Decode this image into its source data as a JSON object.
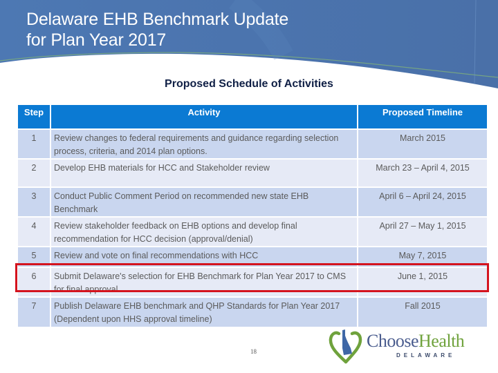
{
  "slide": {
    "title_line1": "Delaware EHB Benchmark Update",
    "title_line2": "for Plan Year 2017",
    "subtitle": "Proposed Schedule of Activities",
    "page_number": "18"
  },
  "table": {
    "headers": {
      "step": "Step",
      "activity": "Activity",
      "timeline": "Proposed Timeline"
    },
    "rows": [
      {
        "step": "1",
        "activity": "Review changes to federal requirements and guidance regarding selection process, criteria, and 2014 plan options.",
        "timeline": "March 2015"
      },
      {
        "step": "2",
        "activity": "Develop EHB materials for HCC and Stakeholder review",
        "timeline": "March 23 – April 4, 2015"
      },
      {
        "step": "3",
        "activity": "Conduct Public Comment Period on recommended new state EHB Benchmark",
        "timeline": "April 6 – April 24, 2015"
      },
      {
        "step": "4",
        "activity": "Review stakeholder feedback on EHB options and develop final recommendation for HCC decision (approval/denial)",
        "timeline": "April 27 – May 1, 2015"
      },
      {
        "step": "5",
        "activity": "Review and vote on final recommendations with HCC",
        "timeline": "May 7, 2015"
      },
      {
        "step": "6",
        "activity": "Submit Delaware's selection for EHB Benchmark for Plan Year 2017 to CMS for final approval",
        "timeline": "June 1, 2015"
      },
      {
        "step": "7",
        "activity": "Publish Delaware EHB benchmark and QHP Standards for Plan Year 2017 (Dependent upon HHS approval timeline)",
        "timeline": "Fall 2015"
      }
    ],
    "highlighted_step": "6"
  },
  "logo": {
    "word1": "Choose",
    "word2": "Health",
    "sub": "DELAWARE",
    "icon": "heart-delaware-icon"
  },
  "colors": {
    "banner_blue": "#4a73ad",
    "header_blue": "#0b7ad3",
    "row_dark": "#c9d6ef",
    "row_light": "#e6eaf6",
    "highlight_red": "#d4131e",
    "logo_blue": "#4a5c8e",
    "logo_green": "#6fa23c"
  }
}
